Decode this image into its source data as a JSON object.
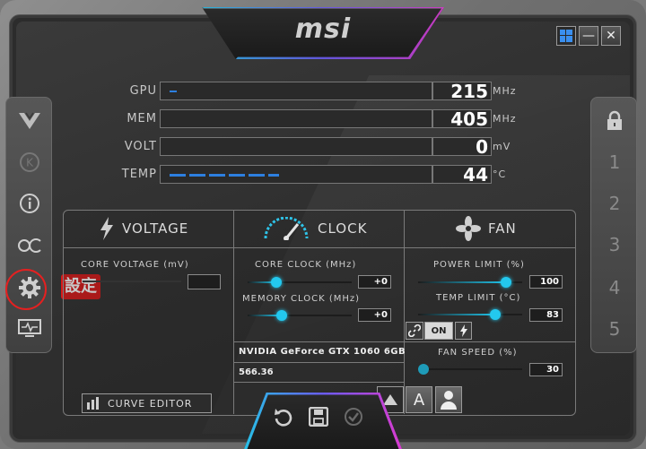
{
  "brand": {
    "logo_text": "msi"
  },
  "window": {
    "minimize": "—",
    "close": "✕"
  },
  "monitor": {
    "rows": [
      {
        "label": "GPU",
        "value": "215",
        "unit": "MHz",
        "fill": 0.06
      },
      {
        "label": "MEM",
        "value": "405",
        "unit": "MHz",
        "fill": 0.03
      },
      {
        "label": "VOLT",
        "value": "0",
        "unit": "mV",
        "fill": 0.0
      },
      {
        "label": "TEMP",
        "value": "44",
        "unit": "°C",
        "fill": 0.44
      }
    ]
  },
  "sidebar_left": {
    "items": [
      {
        "name": "oc-scanner-icon"
      },
      {
        "name": "kombustor-icon"
      },
      {
        "name": "info-icon"
      },
      {
        "name": "oc-icon"
      },
      {
        "name": "settings-icon"
      },
      {
        "name": "monitor-icon"
      }
    ],
    "settings_callout": "設定"
  },
  "sidebar_right": {
    "profiles": [
      "1",
      "2",
      "3",
      "4",
      "5"
    ]
  },
  "voltage": {
    "title": "VOLTAGE",
    "core_voltage_label": "CORE VOLTAGE  (mV)",
    "core_voltage_value": "",
    "curve_editor_label": "CURVE EDITOR"
  },
  "clock": {
    "title": "CLOCK",
    "core_label": "CORE CLOCK (MHz)",
    "core_value": "+0",
    "memory_label": "MEMORY CLOCK (MHz)",
    "memory_value": "+0",
    "gpu_name": "NVIDIA GeForce GTX 1060 6GB",
    "driver_version": "566.36"
  },
  "fan": {
    "title": "FAN",
    "power_limit_label": "POWER LIMIT (%)",
    "power_limit_value": "100",
    "power_limit_level": 1.0,
    "temp_limit_label": "TEMP LIMIT (°C)",
    "temp_limit_value": "83",
    "temp_limit_level": 0.83,
    "link_on_label": "ON",
    "fan_speed_label": "FAN SPEED (%)",
    "fan_speed_value": "30"
  },
  "profile_buttons": {
    "auto_label": "A"
  },
  "colors": {
    "accent_cyan": "#23c8ee",
    "accent_magenta": "#d93bd0",
    "callout_red": "#d91818",
    "bar_blue": "#2d7fe0"
  }
}
